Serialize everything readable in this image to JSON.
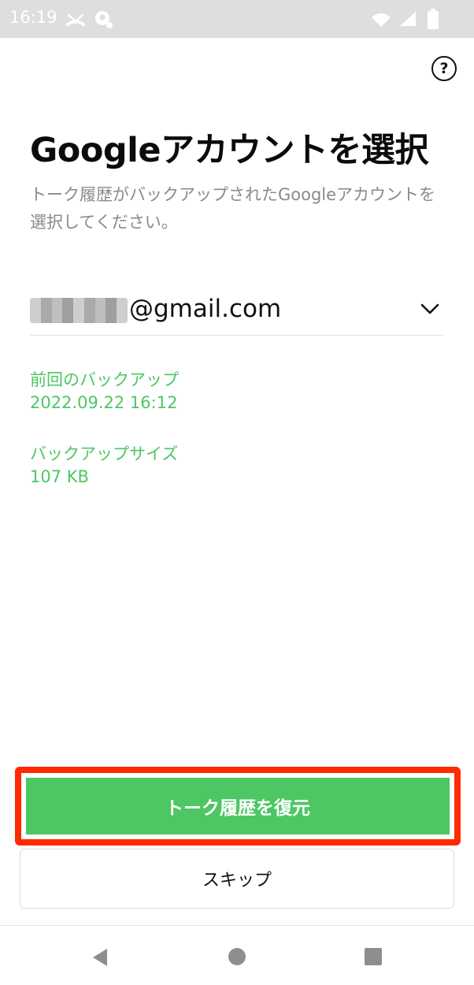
{
  "status_bar": {
    "time": "16:19",
    "icons": [
      "missed-call-icon",
      "assistant-icon",
      "wifi-icon",
      "signal-icon",
      "battery-icon"
    ]
  },
  "header": {
    "help_symbol": "?",
    "help_icon": "help-circle-icon"
  },
  "main": {
    "title": "Googleアカウントを選択",
    "description": "トーク履歴がバックアップされたGoogleアカウントを選択してください。",
    "account": {
      "email_domain": "@gmail.com",
      "dropdown_icon": "chevron-down-icon"
    },
    "last_backup": {
      "label": "前回のバックアップ",
      "value": "2022.09.22 16:12"
    },
    "backup_size": {
      "label": "バックアップサイズ",
      "value": "107 KB"
    }
  },
  "actions": {
    "restore_label": "トーク履歴を復元",
    "skip_label": "スキップ"
  },
  "nav": {
    "icons": [
      "back-icon",
      "home-icon",
      "recents-icon"
    ]
  },
  "colors": {
    "accent_green": "#4cc764",
    "highlight_red": "#ff2a00",
    "status_bar_bg": "#dedede",
    "description_gray": "#8a8a8a"
  }
}
